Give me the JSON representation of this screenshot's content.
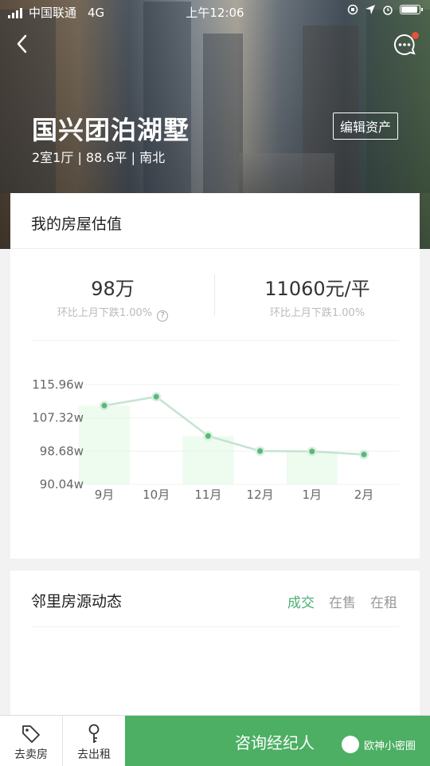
{
  "status_bar": {
    "carrier": "中国联通",
    "network": "4G",
    "time": "上午12:06"
  },
  "property": {
    "name": "国兴团泊湖墅",
    "details": "2室1厅 | 88.6平 | 南北",
    "edit_label": "编辑资产"
  },
  "valuation": {
    "title": "我的房屋估值",
    "total_value": "98万",
    "total_change": "环比上月下跌1.00%",
    "unit_price": "11060元/平",
    "unit_change": "环比上月下跌1.00%"
  },
  "chart_data": {
    "type": "line",
    "categories": [
      "9月",
      "10月",
      "11月",
      "12月",
      "1月",
      "2月"
    ],
    "values": [
      110.5,
      112.8,
      102.6,
      98.7,
      98.6,
      97.8
    ],
    "ylabel": "",
    "yticks": [
      "115.96w",
      "107.32w",
      "98.68w",
      "90.04w"
    ],
    "ylim": [
      90.04,
      115.96
    ],
    "series_color": "#8ec9a0"
  },
  "neighborhood": {
    "title": "邻里房源动态",
    "tabs": [
      "成交",
      "在售",
      "在租"
    ]
  },
  "bottom_bar": {
    "sell_label": "去卖房",
    "rent_label": "去出租",
    "consult_label": "咨询经纪人",
    "watermark": "欧神小密圈"
  }
}
